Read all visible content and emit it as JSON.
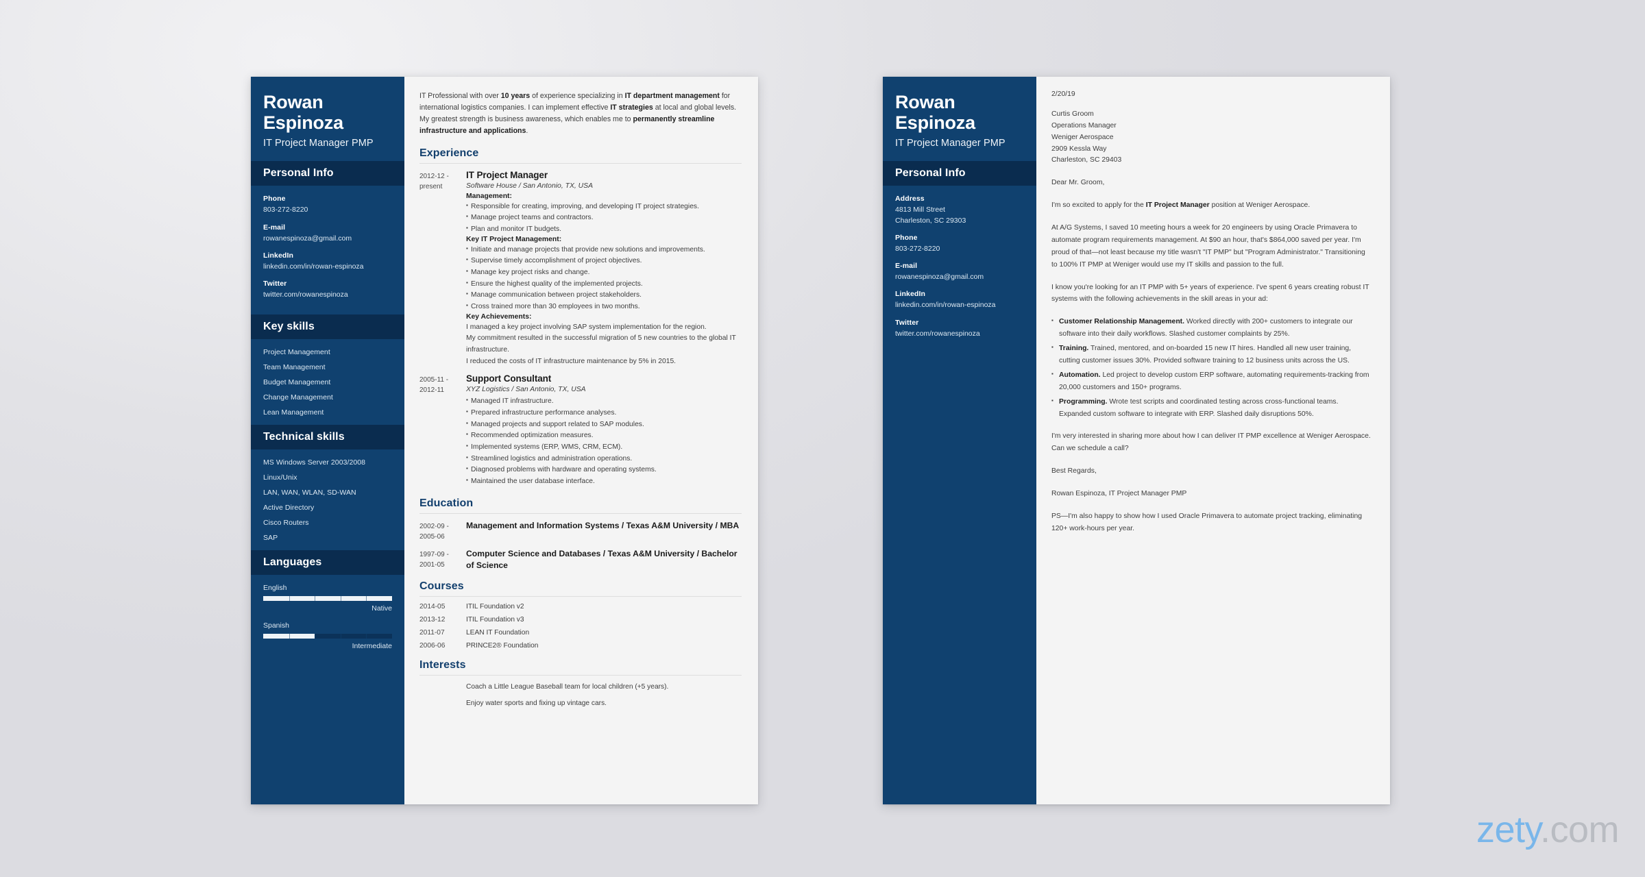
{
  "watermark": {
    "brand": "zety",
    "tld": ".com",
    "brand_color": "#79b6ea",
    "tld_color": "#b9bcc2"
  },
  "theme": {
    "sidebar_blue": "#10416f",
    "band_navy": "#0a2c4f",
    "heading_blue": "#123f6d",
    "page_bg": "#f4f4f4"
  },
  "resume": {
    "sidebar": {
      "first_name": "Rowan",
      "last_name": "Espinoza",
      "job_title": "IT Project Manager PMP",
      "personal_info_heading": "Personal Info",
      "contacts": [
        {
          "label": "Phone",
          "value": "803-272-8220"
        },
        {
          "label": "E-mail",
          "value": "rowanespinoza@gmail.com"
        },
        {
          "label": "LinkedIn",
          "value": "linkedin.com/in/rowan-espinoza"
        },
        {
          "label": "Twitter",
          "value": "twitter.com/rowanespinoza"
        }
      ],
      "key_skills_heading": "Key skills",
      "key_skills": [
        "Project Management",
        "Team Management",
        "Budget Management",
        "Change Management",
        "Lean Management"
      ],
      "technical_skills_heading": "Technical skills",
      "technical_skills": [
        "MS Windows Server 2003/2008",
        "Linux/Unix",
        "LAN, WAN, WLAN, SD-WAN",
        "Active Directory",
        "Cisco Routers",
        "SAP"
      ],
      "languages_heading": "Languages",
      "languages": [
        {
          "name": "English",
          "level": "Native",
          "percent": 100
        },
        {
          "name": "Spanish",
          "level": "Intermediate",
          "percent": 40
        }
      ]
    },
    "summary": [
      {
        "t": "IT Professional with over ",
        "b": false
      },
      {
        "t": "10 years",
        "b": true
      },
      {
        "t": " of experience specializing in ",
        "b": false
      },
      {
        "t": "IT department management",
        "b": true
      },
      {
        "t": " for international logistics companies. I can implement effective ",
        "b": false
      },
      {
        "t": "IT strategies",
        "b": true
      },
      {
        "t": " at local and global levels. My greatest strength is business awareness, which enables me to ",
        "b": false
      },
      {
        "t": "permanently streamline infrastructure and applications",
        "b": true
      },
      {
        "t": ".",
        "b": false
      }
    ],
    "experience_heading": "Experience",
    "experience": [
      {
        "date": "2012-12 - present",
        "role": "IT Project Manager",
        "company": "Software House / San Antonio, TX, USA",
        "groups": [
          {
            "label": "Management:",
            "bullets": [
              "Responsible for creating, improving, and developing IT project strategies.",
              "Manage project teams and contractors.",
              "Plan and monitor IT budgets."
            ],
            "plain": []
          },
          {
            "label": "Key IT Project Management:",
            "bullets": [
              "Initiate and manage projects that provide new solutions and improvements.",
              "Supervise timely accomplishment of project objectives.",
              "Manage key project risks and change.",
              "Ensure the highest quality of the implemented projects.",
              "Manage communication between project stakeholders.",
              "Cross trained more than 30 employees in two months."
            ],
            "plain": []
          },
          {
            "label": "Key Achievements:",
            "bullets": [],
            "plain": [
              "I managed a key project involving SAP system implementation for the region.",
              "My commitment resulted in the successful migration of 5 new countries to the global IT infrastructure.",
              "I reduced the costs of IT infrastructure maintenance by 5% in 2015."
            ]
          }
        ]
      },
      {
        "date": "2005-11 - 2012-11",
        "role": "Support Consultant",
        "company": "XYZ Logistics / San Antonio, TX, USA",
        "groups": [
          {
            "label": "",
            "bullets": [
              "Managed IT infrastructure.",
              "Prepared infrastructure performance analyses.",
              "Managed projects and support related to SAP modules.",
              "Recommended optimization measures.",
              "Implemented systems (ERP, WMS, CRM, ECM).",
              "Streamlined logistics and administration operations.",
              "Diagnosed problems with hardware and operating systems.",
              "Maintained the user database interface."
            ],
            "plain": []
          }
        ]
      }
    ],
    "education_heading": "Education",
    "education": [
      {
        "date": "2002-09 - 2005-06",
        "title": "Management and Information Systems / Texas A&M University / MBA"
      },
      {
        "date": "1997-09 - 2001-05",
        "title": "Computer Science and Databases / Texas A&M University / Bachelor of Science"
      }
    ],
    "courses_heading": "Courses",
    "courses": [
      {
        "date": "2014-05",
        "name": "ITIL Foundation v2"
      },
      {
        "date": "2013-12",
        "name": "ITIL Foundation v3"
      },
      {
        "date": "2011-07",
        "name": "LEAN IT Foundation"
      },
      {
        "date": "2006-06",
        "name": "PRINCE2® Foundation"
      }
    ],
    "interests_heading": "Interests",
    "interests": [
      "Coach a Little League Baseball team for local children (+5 years).",
      "Enjoy water sports and fixing up vintage cars."
    ]
  },
  "letter": {
    "sidebar": {
      "first_name": "Rowan",
      "last_name": "Espinoza",
      "job_title": "IT Project Manager PMP",
      "personal_info_heading": "Personal Info",
      "contacts": [
        {
          "label": "Address",
          "value": "4813 Mill Street\nCharleston, SC 29303"
        },
        {
          "label": "Phone",
          "value": "803-272-8220"
        },
        {
          "label": "E-mail",
          "value": "rowanespinoza@gmail.com"
        },
        {
          "label": "LinkedIn",
          "value": "linkedin.com/in/rowan-espinoza"
        },
        {
          "label": "Twitter",
          "value": "twitter.com/rowanespinoza"
        }
      ]
    },
    "date": "2/20/19",
    "recipient": [
      "Curtis Groom",
      "Operations Manager",
      "Weniger Aerospace",
      "2909 Kessla Way",
      "Charleston, SC 29403"
    ],
    "salutation": "Dear Mr. Groom,",
    "paragraphs": [
      [
        {
          "t": "I'm so excited to apply for the ",
          "b": false
        },
        {
          "t": "IT Project Manager",
          "b": true
        },
        {
          "t": " position at Weniger Aerospace.",
          "b": false
        }
      ],
      [
        {
          "t": "At A/G Systems, I saved 10 meeting hours a week for 20 engineers by using Oracle Primavera to automate program requirements management. At $90 an hour, that's $864,000 saved per year. I'm proud of that—not least because my title wasn't \"IT PMP\" but \"Program Administrator.\" Transitioning to 100% IT PMP at Weniger would use my IT skills and passion to the full.",
          "b": false
        }
      ],
      [
        {
          "t": "I know you're looking for an IT PMP with 5+ years of experience. I've spent 6 years creating robust IT systems with the following achievements in the skill areas in your ad:",
          "b": false
        }
      ]
    ],
    "bullets": [
      {
        "lead": "Customer Relationship Management.",
        "rest": " Worked directly with 200+ customers to integrate our software into their daily workflows. Slashed customer complaints by 25%."
      },
      {
        "lead": "Training.",
        "rest": " Trained, mentored, and on-boarded 15 new IT hires. Handled all new user training, cutting customer issues 30%. Provided software training to 12 business units across the US."
      },
      {
        "lead": "Automation.",
        "rest": " Led project to develop custom ERP software, automating requirements-tracking from 20,000 customers and 150+ programs."
      },
      {
        "lead": "Programming.",
        "rest": " Wrote test scripts and coordinated testing across cross-functional teams. Expanded custom software to integrate with ERP. Slashed daily disruptions 50%."
      }
    ],
    "closing_paragraphs": [
      "I'm very interested in sharing more about how I can deliver IT PMP excellence at Weniger Aerospace. Can we schedule a call?",
      "Best Regards,",
      "Rowan Espinoza, IT Project Manager PMP",
      "PS—I'm also happy to show how I used Oracle Primavera to automate project tracking, eliminating 120+ work-hours per year."
    ]
  }
}
